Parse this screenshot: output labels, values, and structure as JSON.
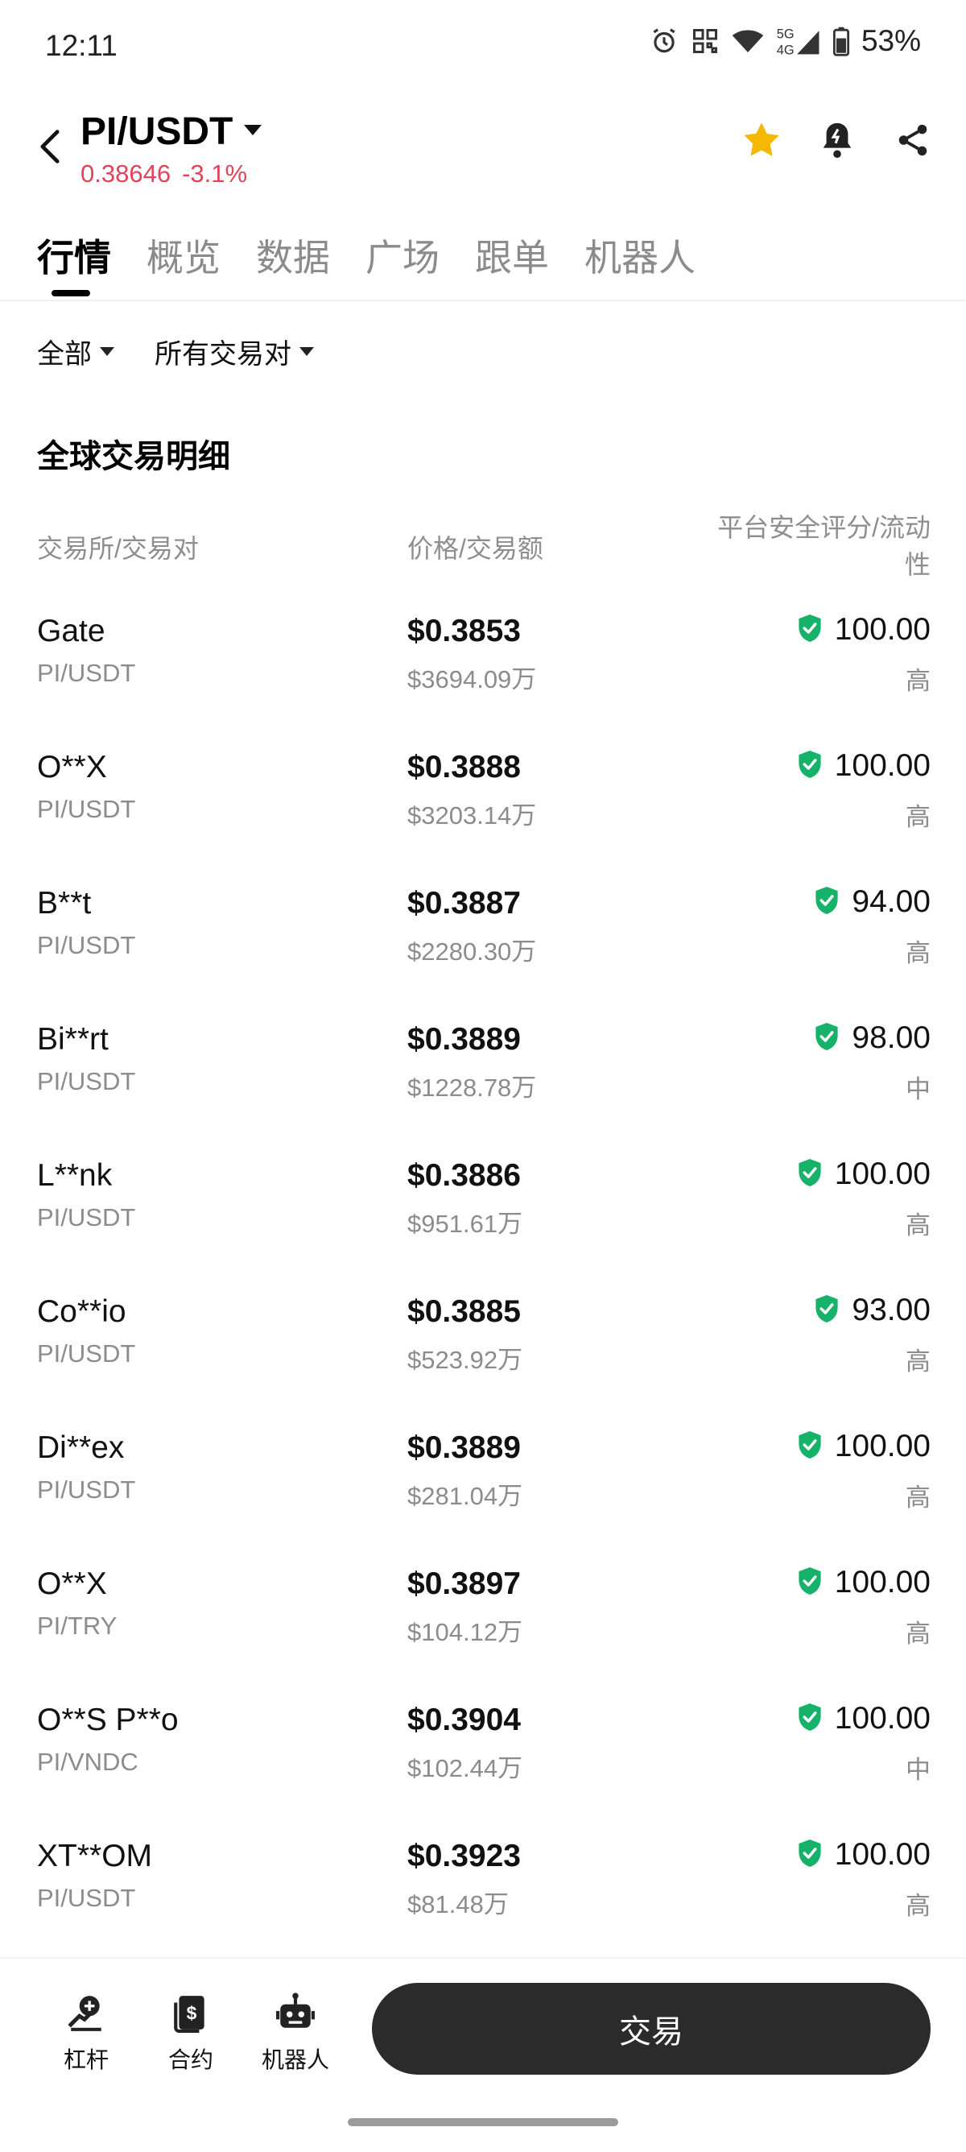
{
  "status_bar": {
    "time": "12:11",
    "battery": "53%",
    "icons": [
      "alarm-icon",
      "nfc-icon",
      "wifi-icon",
      "signal-5g-4g-icon",
      "battery-icon"
    ]
  },
  "header": {
    "pair": "PI/USDT",
    "price": "0.38646",
    "change": "-3.1%",
    "change_color": "#e0435c",
    "favorite_color": "#f5b800"
  },
  "tabs": [
    {
      "label": "行情",
      "active": true
    },
    {
      "label": "概览"
    },
    {
      "label": "数据"
    },
    {
      "label": "广场"
    },
    {
      "label": "跟单"
    },
    {
      "label": "机器人"
    }
  ],
  "filters": [
    {
      "label": "全部"
    },
    {
      "label": "所有交易对"
    }
  ],
  "section_title": "全球交易明细",
  "columns": {
    "exchange": "交易所/交易对",
    "price": "价格/交易额",
    "score_line1": "平台安全评分/流动",
    "score_line2": "性"
  },
  "rows": [
    {
      "exchange": "Gate",
      "pair": "PI/USDT",
      "price": "$0.3853",
      "volume": "$3694.09万",
      "score": "100.00",
      "liquidity": "高"
    },
    {
      "exchange": "O**X",
      "pair": "PI/USDT",
      "price": "$0.3888",
      "volume": "$3203.14万",
      "score": "100.00",
      "liquidity": "高"
    },
    {
      "exchange": "B**t",
      "pair": "PI/USDT",
      "price": "$0.3887",
      "volume": "$2280.30万",
      "score": "94.00",
      "liquidity": "高"
    },
    {
      "exchange": "Bi**rt",
      "pair": "PI/USDT",
      "price": "$0.3889",
      "volume": "$1228.78万",
      "score": "98.00",
      "liquidity": "中"
    },
    {
      "exchange": "L**nk",
      "pair": "PI/USDT",
      "price": "$0.3886",
      "volume": "$951.61万",
      "score": "100.00",
      "liquidity": "高"
    },
    {
      "exchange": "Co**io",
      "pair": "PI/USDT",
      "price": "$0.3885",
      "volume": "$523.92万",
      "score": "93.00",
      "liquidity": "高"
    },
    {
      "exchange": "Di**ex",
      "pair": "PI/USDT",
      "price": "$0.3889",
      "volume": "$281.04万",
      "score": "100.00",
      "liquidity": "高"
    },
    {
      "exchange": "O**X",
      "pair": "PI/TRY",
      "price": "$0.3897",
      "volume": "$104.12万",
      "score": "100.00",
      "liquidity": "高"
    },
    {
      "exchange": "O**S P**o",
      "pair": "PI/VNDC",
      "price": "$0.3904",
      "volume": "$102.44万",
      "score": "100.00",
      "liquidity": "中"
    },
    {
      "exchange": "XT**OM",
      "pair": "PI/USDT",
      "price": "$0.3923",
      "volume": "$81.48万",
      "score": "100.00",
      "liquidity": "高"
    }
  ],
  "shield_color": "#17b26a",
  "bottom_nav": [
    {
      "label": "杠杆",
      "icon": "leverage-icon"
    },
    {
      "label": "合约",
      "icon": "contract-icon"
    },
    {
      "label": "机器人",
      "icon": "robot-icon"
    }
  ],
  "trade_button": "交易"
}
